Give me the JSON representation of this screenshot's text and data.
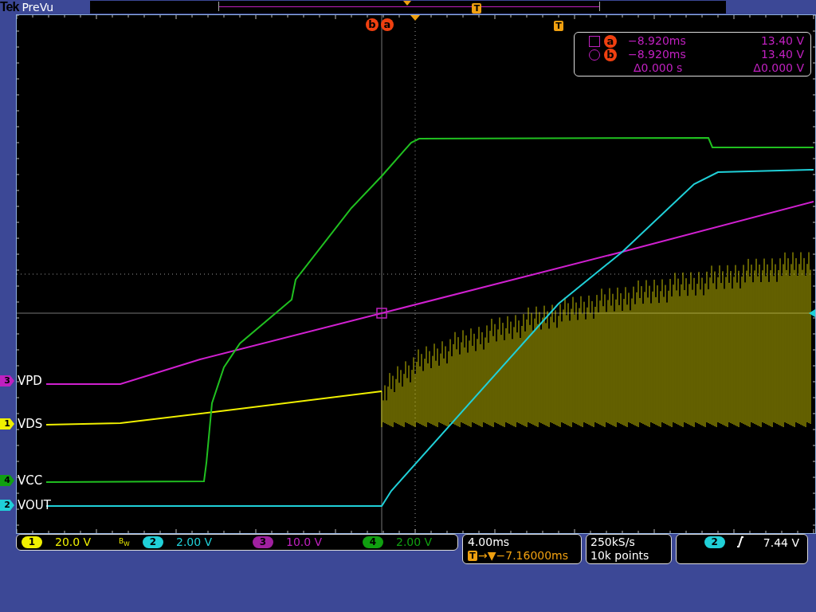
{
  "top_bar": {
    "brand": "Tek",
    "mode": "PreVu",
    "record_trigger_marker": "T"
  },
  "graticule": {
    "cursor_badges": [
      {
        "label": "b"
      },
      {
        "label": "a"
      }
    ],
    "trigger_marker": "T"
  },
  "cursor_readout": {
    "rows": [
      {
        "kind": "square",
        "badge": "a",
        "time": "−8.920ms",
        "value": "13.40 V"
      },
      {
        "kind": "circle",
        "badge": "b",
        "time": "−8.920ms",
        "value": "13.40 V"
      }
    ],
    "delta": {
      "time": "Δ0.000 s",
      "value": "Δ0.000 V"
    }
  },
  "channel_markers": [
    {
      "number": "3",
      "label": "VPD",
      "color": "#c020c0"
    },
    {
      "number": "1",
      "label": "VDS",
      "color": "#f0f000"
    },
    {
      "number": "4",
      "label": "VCC",
      "color": "#10a010"
    },
    {
      "number": "2",
      "label": "VOUT",
      "color": "#20d0d8"
    }
  ],
  "channel_scales": [
    {
      "number": "1",
      "scale": "20.0 V",
      "color": "#f0f000",
      "bandwidth_mark": "B$_{W}$"
    },
    {
      "number": "2",
      "scale": "2.00 V",
      "color": "#20d0d8"
    },
    {
      "number": "3",
      "scale": "10.0 V",
      "color": "#a020a0"
    },
    {
      "number": "4",
      "scale": "2.00 V",
      "color": "#10a010"
    }
  ],
  "timebase": {
    "scale": "4.00ms",
    "trigger_badge": "T",
    "position": "→▼−7.16000ms"
  },
  "acquisition": {
    "sample_rate": "250kS/s",
    "record_length": "10k points"
  },
  "trigger": {
    "channel": "2",
    "level": "7.44 V",
    "color": "#20d0d8"
  }
}
